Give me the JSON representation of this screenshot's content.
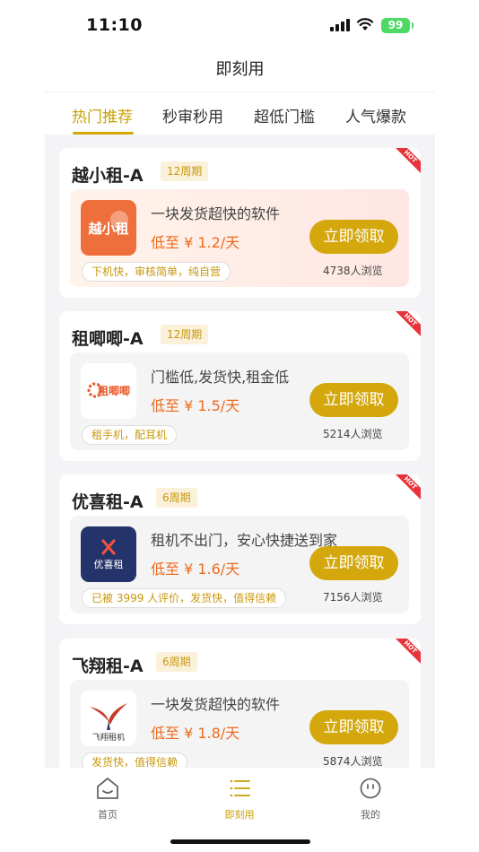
{
  "status": {
    "time": "11:10",
    "battery": "99"
  },
  "header": {
    "title": "即刻用"
  },
  "tabs": [
    {
      "label": "热门推荐",
      "active": true
    },
    {
      "label": "秒审秒用",
      "active": false
    },
    {
      "label": "超低门槛",
      "active": false
    },
    {
      "label": "人气爆款",
      "active": false
    }
  ],
  "cards": [
    {
      "name": "越小租-A",
      "period": "12周期",
      "desc": "一块发货超快的软件",
      "price": "低至 ¥ 1.2/天",
      "button": "立即领取",
      "tag": "下机快，审核简单，纯自营",
      "views": "4738人浏览",
      "logo_text": "越小租",
      "hot": "HOT"
    },
    {
      "name": "租唧唧-A",
      "period": "12周期",
      "desc": "门槛低,发货快,租金低",
      "price": "低至 ¥ 1.5/天",
      "button": "立即领取",
      "tag": "租手机，配耳机",
      "views": "5214人浏览",
      "logo_text": "租唧唧",
      "hot": "HOT"
    },
    {
      "name": "优喜租-A",
      "period": "6周期",
      "desc": "租机不出门，安心快捷送到家",
      "price": "低至 ¥ 1.6/天",
      "button": "立即领取",
      "tag": "已被 3999 人评价，发货快，值得信赖",
      "views": "7156人浏览",
      "logo_text": "优喜租",
      "hot": "HOT"
    },
    {
      "name": "飞翔租-A",
      "period": "6周期",
      "desc": "一块发货超快的软件",
      "price": "低至 ¥ 1.8/天",
      "button": "立即领取",
      "tag": "发货快，值得信赖",
      "views": "5874人浏览",
      "logo_text": "飞翔租机",
      "hot": "HOT"
    }
  ],
  "nav": [
    {
      "label": "首页",
      "icon": "home-icon",
      "active": false
    },
    {
      "label": "即刻用",
      "icon": "list-icon",
      "active": true
    },
    {
      "label": "我的",
      "icon": "smile-icon",
      "active": false
    }
  ],
  "colors": {
    "accent": "#d4a80d",
    "price": "#ee6a1c",
    "hot": "#e8333a"
  }
}
